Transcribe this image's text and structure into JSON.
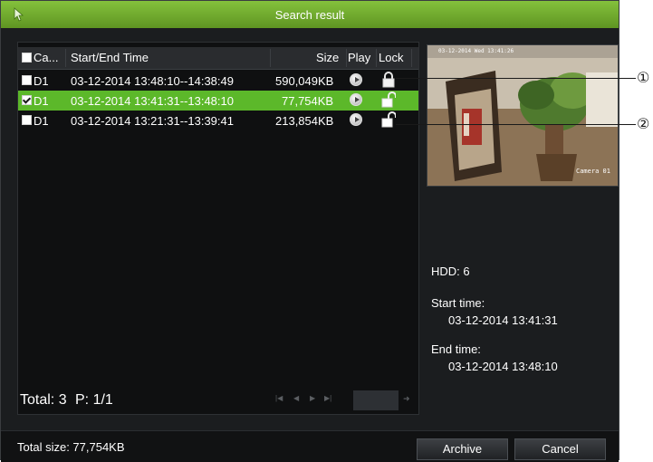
{
  "window": {
    "title": "Search result"
  },
  "list": {
    "header": {
      "camera": "Ca...",
      "time": "Start/End Time",
      "size": "Size",
      "play": "Play",
      "lock": "Lock"
    },
    "rows": [
      {
        "camera": "D1",
        "time": "03-12-2014 13:48:10--14:38:49",
        "size": "590,049KB",
        "checked": false,
        "selected": false,
        "lock": "locked"
      },
      {
        "camera": "D1",
        "time": "03-12-2014 13:41:31--13:48:10",
        "size": "77,754KB",
        "checked": true,
        "selected": true,
        "lock": "unlocked"
      },
      {
        "camera": "D1",
        "time": "03-12-2014 13:21:31--13:39:41",
        "size": "213,854KB",
        "checked": false,
        "selected": false,
        "lock": "unlocked"
      }
    ],
    "total": "Total: 3",
    "page": "P: 1/1"
  },
  "preview": {
    "timestamp": "03-12-2014 Wed 13:41:26",
    "camera_label": "Camera 01"
  },
  "info": {
    "hdd": "HDD: 6",
    "start_label": "Start time:",
    "start_value": "03-12-2014 13:41:31",
    "end_label": "End time:",
    "end_value": "03-12-2014 13:48:10"
  },
  "footer": {
    "total_size": "Total size: 77,754KB",
    "archive_label": "Archive",
    "cancel_label": "Cancel"
  },
  "callouts": [
    "①",
    "②"
  ],
  "colors": {
    "accent": "#5cb82a",
    "titlebar": "#6fae2f",
    "background": "#1b1d1f"
  },
  "icons": [
    "cursor-icon",
    "checkbox-icon",
    "play-icon",
    "lock-icon",
    "unlock-icon",
    "pager-first-icon",
    "pager-prev-icon",
    "pager-next-icon",
    "pager-last-icon"
  ]
}
